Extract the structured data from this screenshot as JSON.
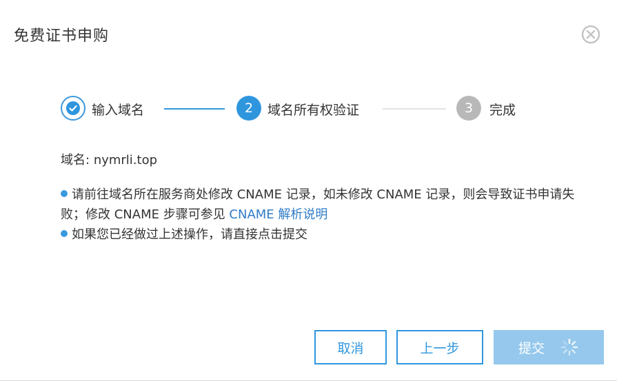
{
  "dialog": {
    "title": "免费证书申购",
    "close_icon": "close-circle-icon"
  },
  "steps": [
    {
      "label": "输入域名",
      "state": "done",
      "icon": "check-icon"
    },
    {
      "label": "域名所有权验证",
      "state": "active",
      "number": "2"
    },
    {
      "label": "完成",
      "state": "todo",
      "number": "3"
    }
  ],
  "domain": {
    "label": "域名:",
    "value": "nymrli.top"
  },
  "notes": {
    "line1_text": "请前往域名所在服务商处修改 CNAME 记录，如未修改 CNAME 记录，则会导致证书申请失败；修改 CNAME 步骤可参见 ",
    "line1_link": "CNAME 解析说明",
    "line2_text": "如果您已经做过上述操作，请直接点击提交"
  },
  "buttons": {
    "cancel": "取消",
    "previous": "上一步",
    "submit": "提交",
    "submit_state": "loading",
    "spinner_icon": "loading-spinner-icon"
  },
  "colors": {
    "accent": "#2f96de",
    "inactive_step": "#b8b8b8",
    "submit_disabled": "#95c8ec",
    "link": "#2f7cc7"
  }
}
